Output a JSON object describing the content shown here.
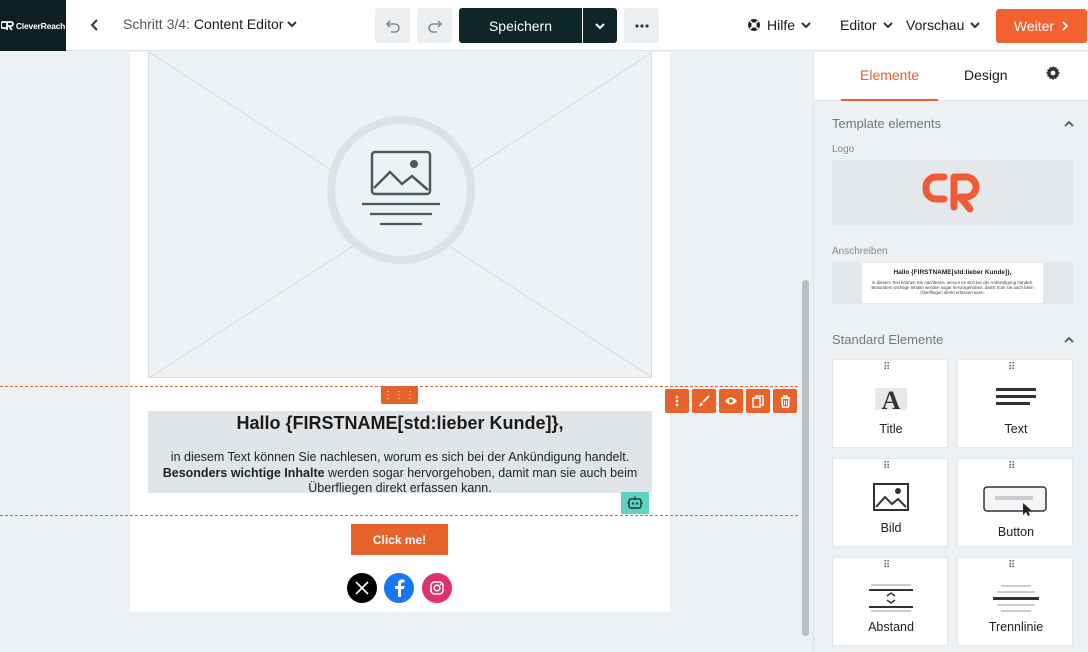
{
  "header": {
    "logo_text": "CleverReach",
    "step_prefix": "Schritt 3/4:",
    "step_name": "Content Editor",
    "save_label": "Speichern",
    "help_label": "Hilfe",
    "editor_label": "Editor",
    "preview_label": "Vorschau",
    "next_label": "Weiter"
  },
  "canvas": {
    "drag_handle": "⋮⋮⋮",
    "text_block": {
      "title": "Hallo {FIRSTNAME[std:lieber Kunde]},",
      "line1": "in diesem Text können Sie nachlesen, worum es sich bei der Ankündigung handelt.",
      "bold": "Besonders wichtige Inhalte",
      "line2": " werden sogar hervorgehoben, damit man sie auch beim Überfliegen direkt erfassen kann."
    },
    "button_label": "Click me!",
    "social": [
      "x-icon",
      "facebook-icon",
      "instagram-icon"
    ]
  },
  "panel": {
    "tabs": [
      "Elemente",
      "Design"
    ],
    "active_tab": "Elemente",
    "template_section": "Template elements",
    "logo_label": "Logo",
    "anschreiben_label": "Anschreiben",
    "anschreiben_preview": {
      "title": "Hallo {FIRSTNAME[std:lieber Kunde]},",
      "text": "in diesem Text können Sie nachlesen, worum es sich bei der Ankündigung handelt. Besonders wichtige Inhalte werden sogar hervorgehoben, damit man sie auch beim Überfliegen direkt erfassen kann."
    },
    "standard_section": "Standard Elemente",
    "elements": [
      {
        "label": "Title",
        "icon": "title-icon"
      },
      {
        "label": "Text",
        "icon": "text-icon"
      },
      {
        "label": "Bild",
        "icon": "image-icon"
      },
      {
        "label": "Button",
        "icon": "button-icon"
      },
      {
        "label": "Abstand",
        "icon": "spacer-icon"
      },
      {
        "label": "Trennlinie",
        "icon": "divider-icon"
      }
    ]
  },
  "colors": {
    "brand_orange": "#e6622b",
    "next_button": "#f2612f",
    "dark": "#0f2629",
    "robot": "#5ed3c2"
  }
}
